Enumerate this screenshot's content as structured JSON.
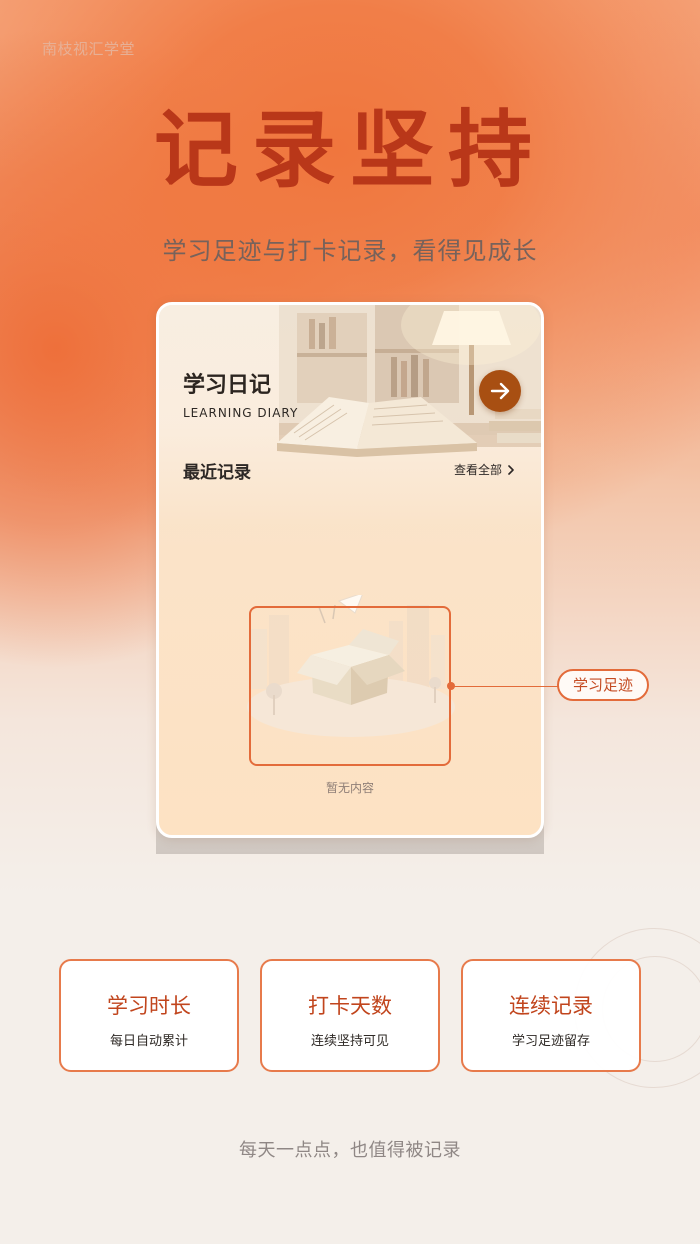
{
  "brand": "南枝视汇学堂",
  "title": "记录坚持",
  "subtitle": "学习足迹与打卡记录，看得见成长",
  "phone": {
    "diary_title": "学习日记",
    "diary_en": "LEARNING DIARY",
    "recent_title": "最近记录",
    "view_all_label": "查看全部",
    "empty_text": "暂无内容"
  },
  "callout": "学习足迹",
  "features": [
    {
      "name": "学习时长",
      "desc": "每日自动累计"
    },
    {
      "name": "打卡天数",
      "desc": "连续坚持可见"
    },
    {
      "name": "连续记录",
      "desc": "学习足迹留存"
    }
  ],
  "footer": "每天一点点，也值得被记录",
  "colors": {
    "title_red": "#b93719",
    "accent_orange": "#e36b3a",
    "arrow_button": "#a84f12"
  },
  "icons": {
    "arrow_button": "arrow-right-icon",
    "view_all": "chevron-right-icon",
    "empty_state": "empty-box-icon"
  }
}
